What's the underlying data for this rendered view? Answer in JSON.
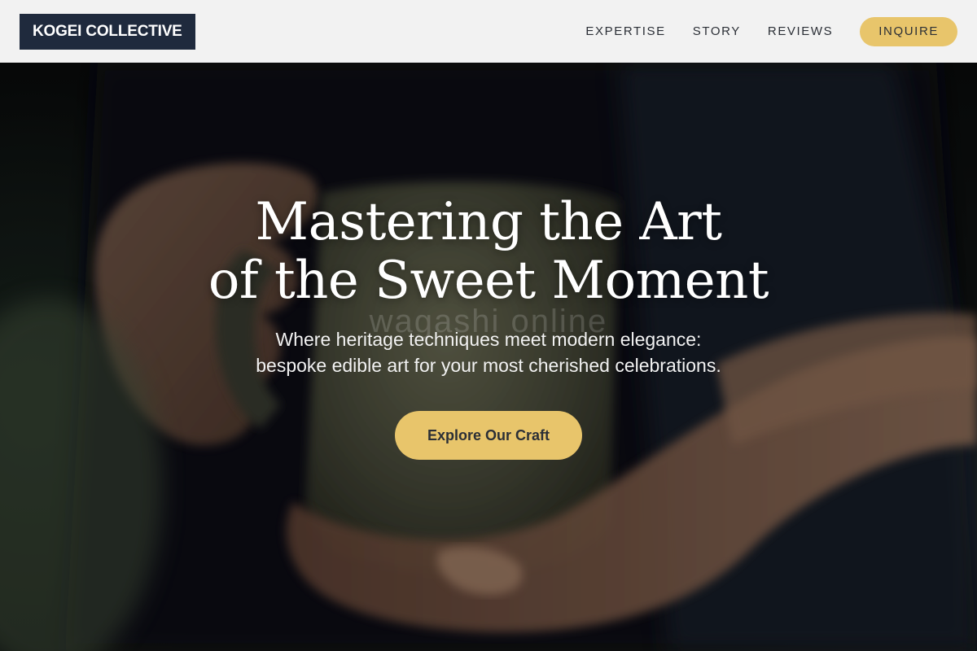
{
  "brand": {
    "name": "KOGEI COLLECTIVE"
  },
  "nav": {
    "links": [
      {
        "label": "EXPERTISE"
      },
      {
        "label": "STORY"
      },
      {
        "label": "REVIEWS"
      }
    ],
    "cta_label": "INQUIRE"
  },
  "hero": {
    "title_line1": "Mastering the Art",
    "title_line2": "of the Sweet Moment",
    "watermark": "wagashi online",
    "subtitle_line1": "Where heritage techniques meet modern elegance:",
    "subtitle_line2": "bespoke edible art for your most cherished celebrations.",
    "cta_label": "Explore Our Craft",
    "image_description": "hands-holding-ceramic-cup"
  },
  "colors": {
    "accent": "#e8c56b",
    "brand_bg": "#1f2a3d",
    "header_bg": "#f2f2f2",
    "nav_text": "#2b2f36"
  }
}
